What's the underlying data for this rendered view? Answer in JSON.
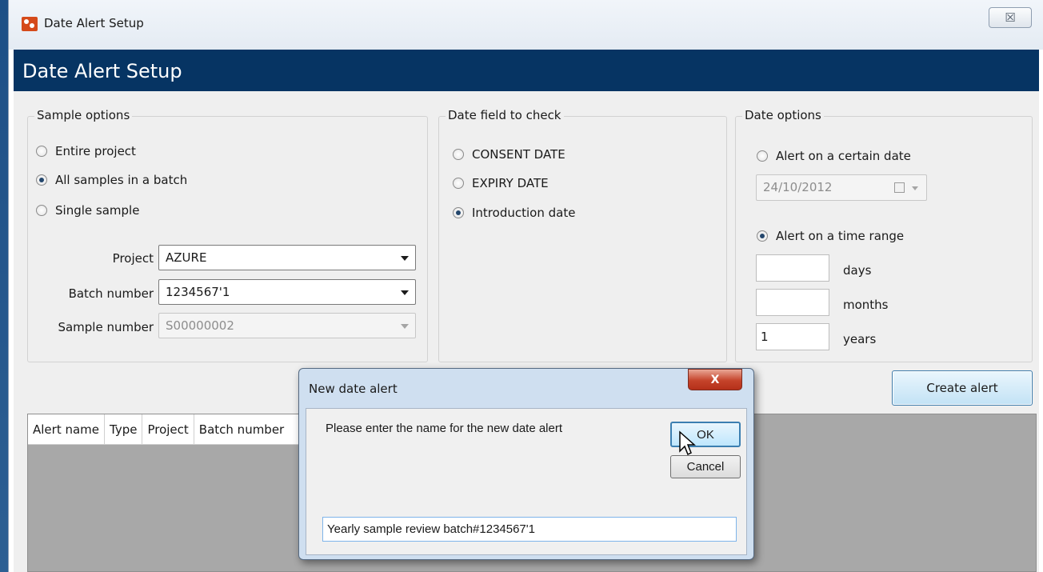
{
  "window": {
    "title": "Date Alert Setup",
    "close_glyph": "☒"
  },
  "header": {
    "title": "Date Alert Setup"
  },
  "sample_options": {
    "legend": "Sample options",
    "radios": [
      {
        "label": "Entire project",
        "checked": false
      },
      {
        "label": "All samples in a batch",
        "checked": true
      },
      {
        "label": "Single sample",
        "checked": false
      }
    ],
    "project_label": "Project",
    "project_value": "AZURE",
    "batch_label": "Batch number",
    "batch_value": "1234567'1",
    "sample_label": "Sample number",
    "sample_value": "S00000002"
  },
  "date_field": {
    "legend": "Date field to check",
    "radios": [
      {
        "label": "CONSENT DATE",
        "checked": false
      },
      {
        "label": "EXPIRY DATE",
        "checked": false
      },
      {
        "label": "Introduction date",
        "checked": true
      }
    ]
  },
  "date_options": {
    "legend": "Date options",
    "certain_label": "Alert on a certain date",
    "certain_checked": false,
    "certain_date": "24/10/2012",
    "range_label": "Alert on a time range",
    "range_checked": true,
    "days_value": "",
    "days_label": "days",
    "months_value": "",
    "months_label": "months",
    "years_value": "1",
    "years_label": "years"
  },
  "create_button": "Create alert",
  "grid": {
    "columns": [
      "Alert name",
      "Type",
      "Project",
      "Batch number"
    ]
  },
  "dialog": {
    "title": "New date alert",
    "close_glyph": "X",
    "prompt": "Please enter the name for the new date alert",
    "ok": "OK",
    "cancel": "Cancel",
    "input_value": "Yearly sample review batch#1234567'1"
  },
  "colors": {
    "header_band": "#063463",
    "accent": "#3c7fb1"
  }
}
